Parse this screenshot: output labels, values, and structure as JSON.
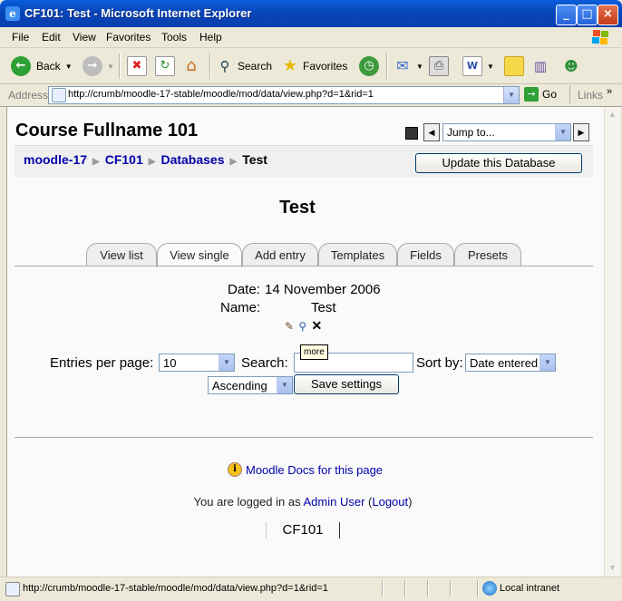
{
  "window": {
    "title": "CF101: Test - Microsoft Internet Explorer"
  },
  "menu": [
    "File",
    "Edit",
    "View",
    "Favorites",
    "Tools",
    "Help"
  ],
  "toolbar": {
    "back": "Back",
    "search": "Search",
    "favorites": "Favorites"
  },
  "address": {
    "label": "Address",
    "url": "http://crumb/moodle-17-stable/moodle/mod/data/view.php?d=1&rid=1",
    "go": "Go",
    "links": "Links"
  },
  "page": {
    "course_title": "Course Fullname 101",
    "jump_to": "Jump to...",
    "breadcrumb": [
      "moodle-17",
      "CF101",
      "Databases",
      "Test"
    ],
    "update_button": "Update this Database",
    "db_title": "Test",
    "tabs": [
      "View list",
      "View single",
      "Add entry",
      "Templates",
      "Fields",
      "Presets"
    ],
    "active_tab": "View single",
    "entry": {
      "date_label": "Date:",
      "date_value": "14 November 2006",
      "name_label": "Name:",
      "name_value": "Test"
    },
    "tooltip": "more",
    "controls": {
      "entries_label": "Entries per page:",
      "entries_value": "10",
      "search_label": "Search:",
      "search_value": "",
      "sort_label": "Sort by:",
      "sort_value": "Date entered",
      "order_value": "Ascending",
      "save_button": "Save settings"
    },
    "docs_link": "Moodle Docs for this page",
    "login": {
      "prefix": "You are logged in as",
      "user": "Admin User",
      "logout": "Logout"
    },
    "footer_course": "CF101"
  },
  "status": {
    "text": "http://crumb/moodle-17-stable/moodle/mod/data/view.php?d=1&rid=1",
    "zone": "Local intranet"
  }
}
